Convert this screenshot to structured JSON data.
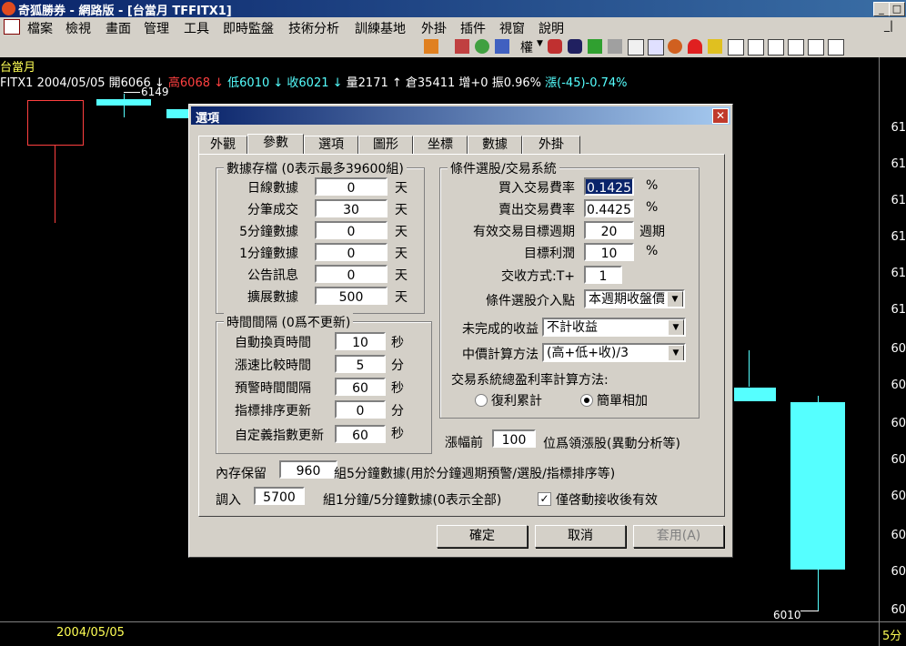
{
  "window": {
    "title": "奇狐勝券 - 網路版 - [台當月 TFFITX1]"
  },
  "menu": [
    "檔案",
    "檢視",
    "畫面",
    "管理",
    "工具",
    "即時監盤",
    "技術分析",
    "訓練基地",
    "外掛",
    "插件",
    "視窗",
    "說明"
  ],
  "toolbar": {
    "rights_label": "權"
  },
  "chart": {
    "symbol_name": "台當月",
    "info_symbol": "FITX1",
    "info_date": "2004/05/05",
    "info_open": "開6066 ↓",
    "info_high": "高6068 ↓",
    "info_low": "低6010 ↓",
    "info_close": "收6021 ↓",
    "info_volume": "量2171 ↑",
    "info_oi": "倉35411",
    "info_change_oi": "增+0",
    "info_amp": "振0.96%",
    "info_pct": "漲(-45)-0.74%",
    "high_marker": "6149",
    "low_marker": "6010",
    "date_label": "2004/05/05",
    "period_label": "5分",
    "axis_labels": [
      "61",
      "61",
      "61",
      "61",
      "61",
      "61",
      "60",
      "60",
      "60",
      "60",
      "60",
      "60",
      "60",
      "60"
    ],
    "colors": {
      "up": "#ff4040",
      "down": "#55ffff",
      "highlight": "#ffff55"
    }
  },
  "dialog": {
    "title": "選項",
    "tabs": [
      "外觀",
      "參數",
      "選項",
      "圖形",
      "坐標",
      "數據",
      "外掛"
    ],
    "active_tab": "參數",
    "data_storage": {
      "title": "數據存檔 (0表示最多39600組)",
      "rows": [
        {
          "label": "日線數據",
          "value": "0",
          "unit": "天"
        },
        {
          "label": "分筆成交",
          "value": "30",
          "unit": "天"
        },
        {
          "label": "5分鐘數據",
          "value": "0",
          "unit": "天"
        },
        {
          "label": "1分鐘數據",
          "value": "0",
          "unit": "天"
        },
        {
          "label": "公告訊息",
          "value": "0",
          "unit": "天"
        },
        {
          "label": "擴展數據",
          "value": "500",
          "unit": "天"
        }
      ]
    },
    "interval": {
      "title": "時間間隔 (0爲不更新)",
      "rows": [
        {
          "label": "自動換頁時間",
          "value": "10",
          "unit": "秒"
        },
        {
          "label": "漲速比較時間",
          "value": "5",
          "unit": "分"
        },
        {
          "label": "預警時間間隔",
          "value": "60",
          "unit": "秒"
        },
        {
          "label": "指標排序更新",
          "value": "0",
          "unit": "分"
        },
        {
          "label": "自定義指數更新",
          "value": "60",
          "unit": "秒"
        }
      ]
    },
    "trading": {
      "title": "條件選股/交易系統",
      "buy_fee_label": "買入交易費率",
      "buy_fee": "0.1425",
      "buy_fee_unit": "%",
      "sell_fee_label": "賣出交易費率",
      "sell_fee": "0.4425",
      "sell_fee_unit": "%",
      "period_label": "有效交易目標週期",
      "period": "20",
      "period_unit": "週期",
      "target_label": "目標利潤",
      "target": "10",
      "target_unit": "%",
      "settle_label": "交收方式:T+",
      "settle": "1",
      "entry_label": "條件選股介入點",
      "entry": "本週期收盤價",
      "unfinished_label": "未完成的收益",
      "unfinished": "不計收益",
      "mid_label": "中價計算方法",
      "mid": "(高+低+收)/3",
      "profit_method_label": "交易系統總盈利率計算方法:",
      "radio_compound": "復利累計",
      "radio_simple": "簡單相加",
      "radio_selected": "簡單相加"
    },
    "rank": {
      "prefix": "漲幅前",
      "value": "100",
      "suffix": "位爲領漲股(異動分析等)"
    },
    "memory": {
      "prefix": "內存保留",
      "value": "960",
      "suffix": "組5分鐘數據(用於分鐘週期預警/選股/指標排序等)"
    },
    "load": {
      "prefix": "調入",
      "value": "5700",
      "suffix": "組1分鐘/5分鐘數據(0表示全部)"
    },
    "checkbox": {
      "label": "僅啓動接收後有效",
      "checked": true
    },
    "buttons": {
      "ok": "確定",
      "cancel": "取消",
      "apply": "套用(A)"
    }
  }
}
